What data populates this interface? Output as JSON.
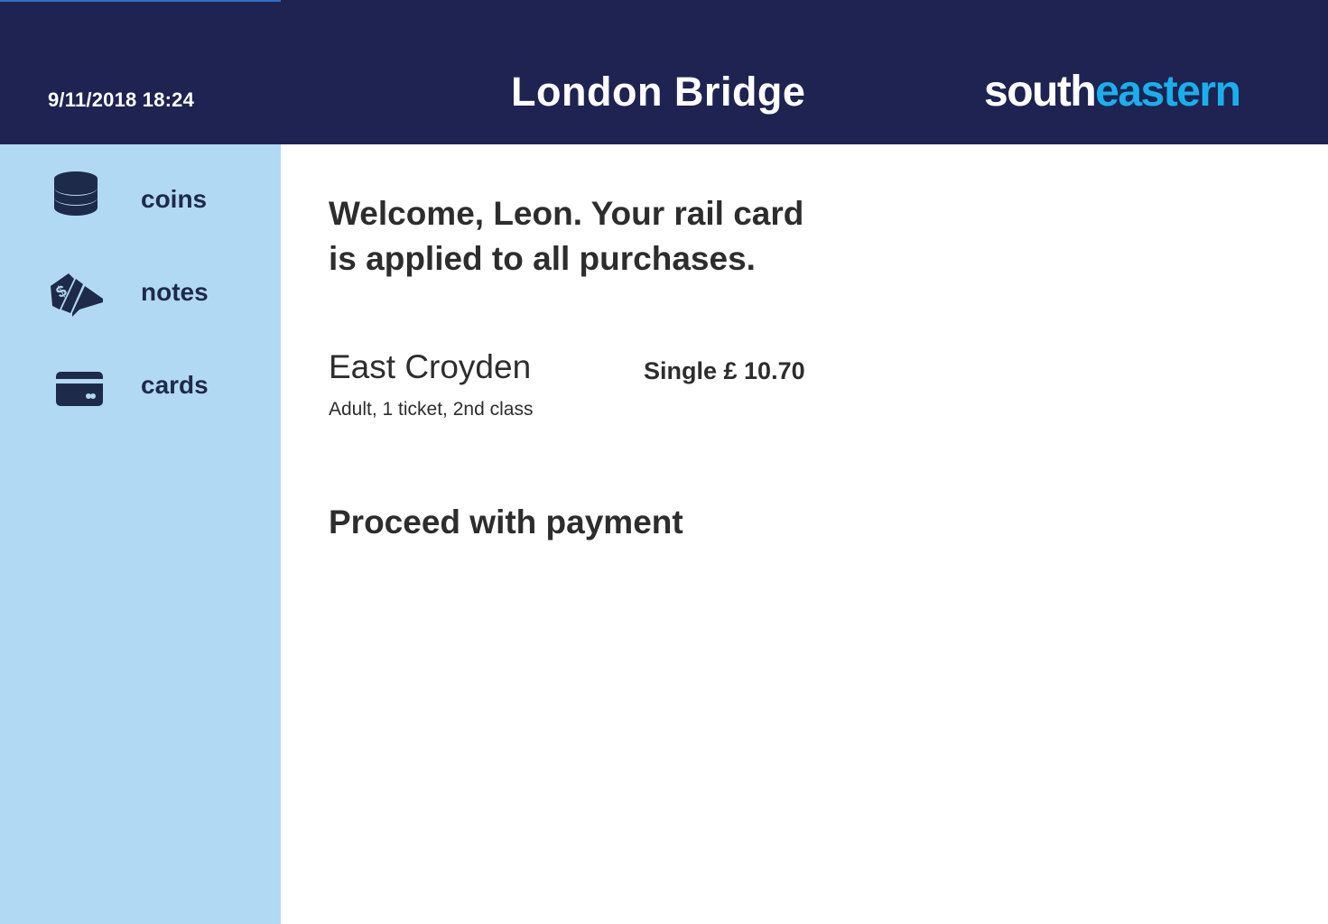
{
  "header": {
    "datetime": "9/11/2018 18:24",
    "station": "London Bridge",
    "brand_part1": "south",
    "brand_part2": "eastern"
  },
  "sidebar": {
    "items": [
      {
        "label": "coins",
        "icon": "coins-icon"
      },
      {
        "label": "notes",
        "icon": "banknotes-icon"
      },
      {
        "label": "cards",
        "icon": "credit-card-icon"
      }
    ]
  },
  "main": {
    "welcome": "Welcome, Leon. Your rail card is applied to all purchases.",
    "ticket": {
      "destination": "East Croyden",
      "details": "Adult, 1 ticket, 2nd class",
      "fare": "Single £ 10.70"
    },
    "proceed_label": "Proceed with payment"
  },
  "colors": {
    "header_bg": "#1e2352",
    "sidebar_bg": "#b2d9f4",
    "brand_accent": "#18b0ec",
    "text_dark": "#2d2d2d",
    "icon_navy": "#1e2a4a"
  }
}
